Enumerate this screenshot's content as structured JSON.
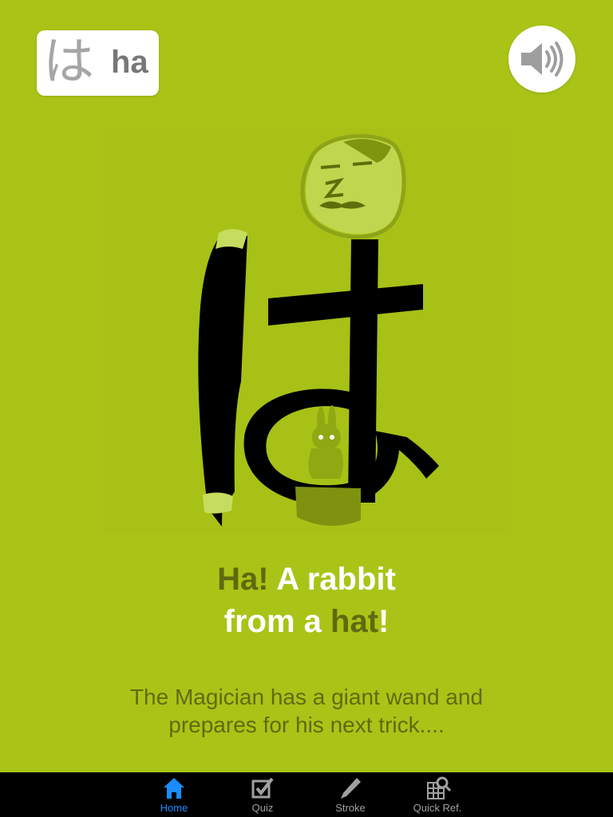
{
  "header": {
    "kana": "は",
    "romaji": "ha",
    "sound_icon": "speaker-icon"
  },
  "card": {
    "title_line1_dark": "Ha!",
    "title_line1_light": " A rabbit",
    "title_line2_light_a": "from a ",
    "title_line2_dark": "hat",
    "title_line2_light_b": "!",
    "description_line1": "The Magician has a giant wand and",
    "description_line2": "prepares for his next trick...."
  },
  "tabs": [
    {
      "label": "Home",
      "icon": "home-icon",
      "active": true
    },
    {
      "label": "Quiz",
      "icon": "checkbox-icon",
      "active": false
    },
    {
      "label": "Stroke",
      "icon": "pencil-icon",
      "active": false
    },
    {
      "label": "Quick Ref.",
      "icon": "grid-search-icon",
      "active": false
    }
  ],
  "colors": {
    "background": "#a9c417",
    "dark_text": "#5e6a0e",
    "active_tab": "#1a8cff"
  }
}
